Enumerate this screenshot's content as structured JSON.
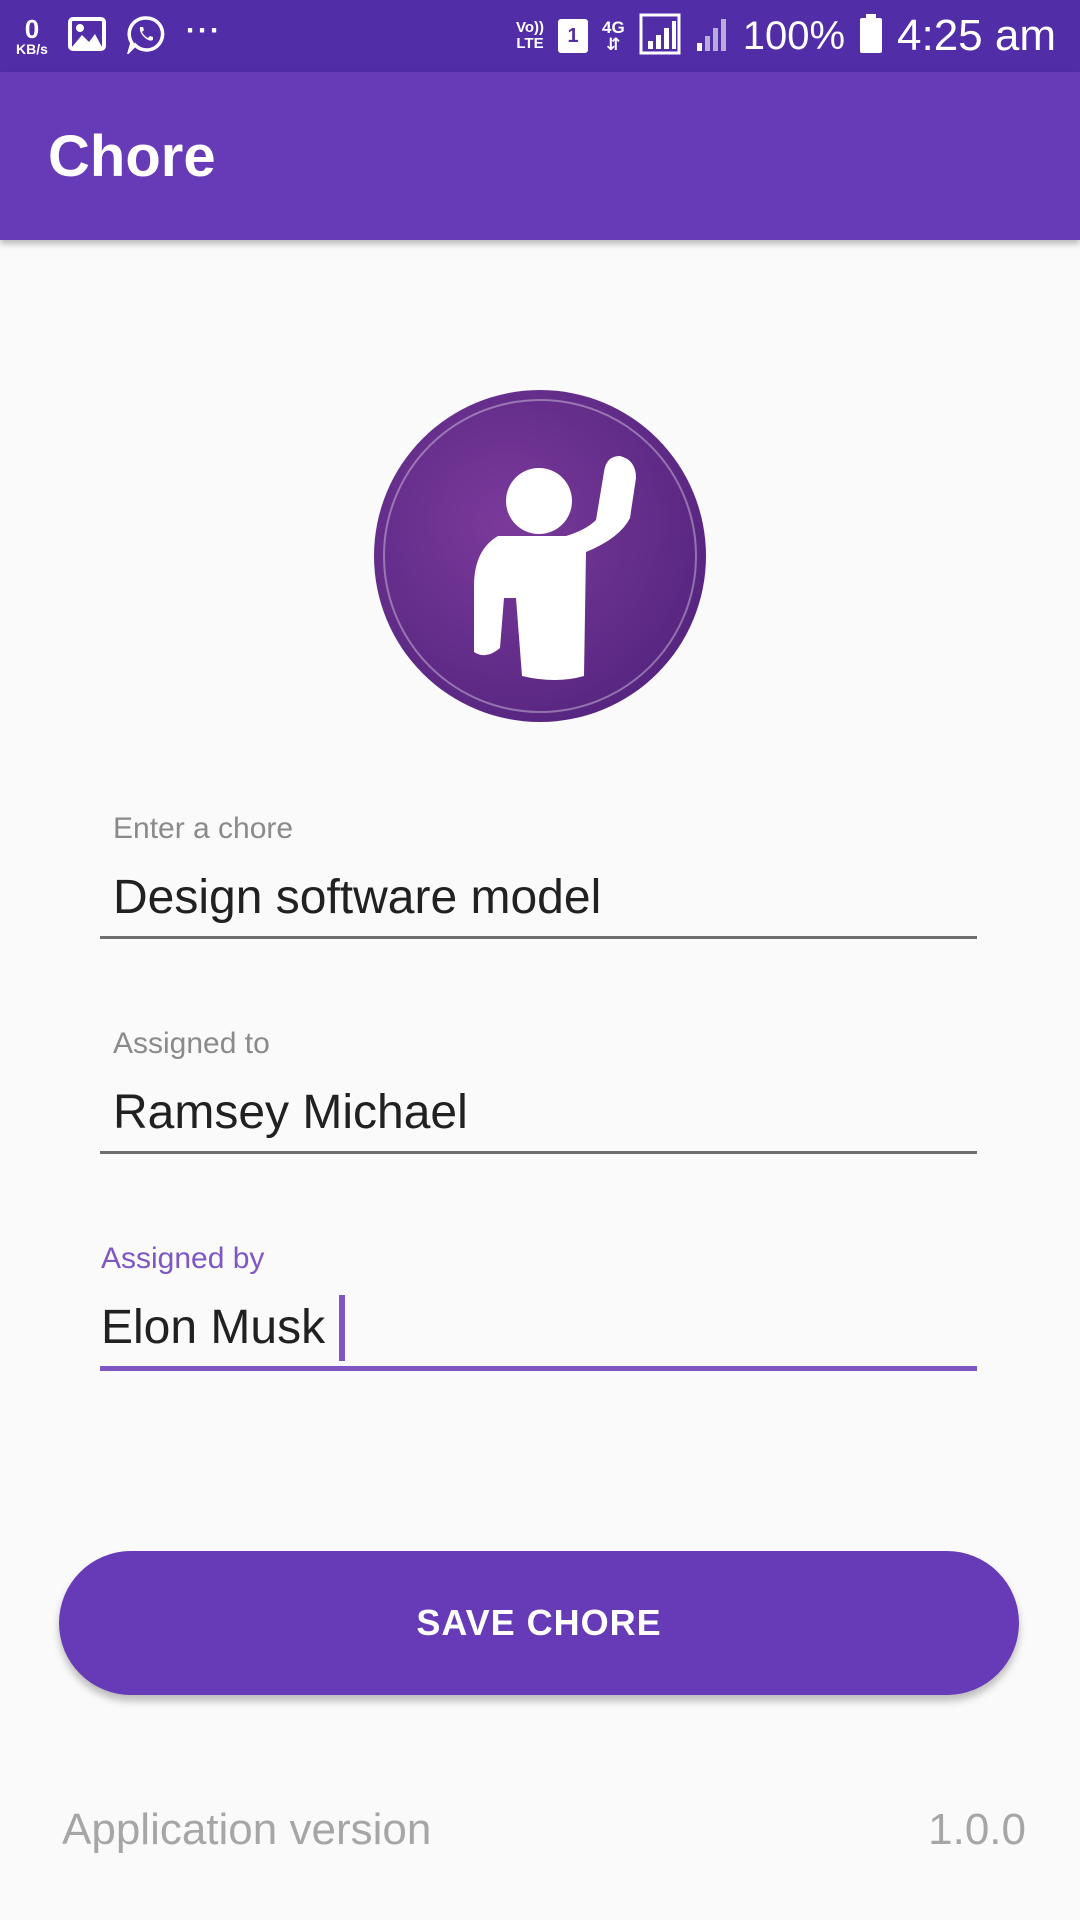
{
  "status_bar": {
    "network_speed_value": "0",
    "network_speed_unit": "KB/s",
    "overflow_dots": "···",
    "volte_top": "Vo))",
    "volte_bottom": "LTE",
    "sim_slot": "1",
    "network_type": "4G",
    "network_arrows": "⇵",
    "battery_percent": "100%",
    "time": "4:25 am",
    "icons": [
      "gallery-icon",
      "whatsapp-icon",
      "signal-icon",
      "battery-icon"
    ]
  },
  "app_bar": {
    "title": "Chore"
  },
  "avatar": {
    "icon": "person-waving-icon"
  },
  "form": {
    "chore": {
      "label": "Enter a chore",
      "value": "Design software model"
    },
    "assigned_to": {
      "label": "Assigned to",
      "value": "Ramsey Michael"
    },
    "assigned_by": {
      "label": "Assigned by",
      "value": "Elon Musk"
    }
  },
  "save_button": {
    "label": "SAVE CHORE"
  },
  "footer": {
    "label": "Application version",
    "version": "1.0.0"
  },
  "colors": {
    "status_bar": "#512da8",
    "primary": "#673ab7",
    "accent": "#7e57c2",
    "background": "#fafafa",
    "avatar": "#5e2a86"
  }
}
